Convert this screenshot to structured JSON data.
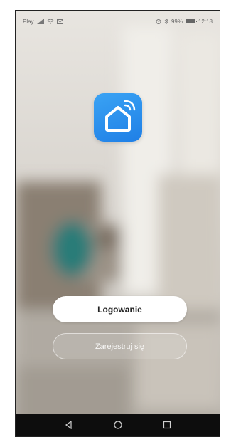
{
  "status_bar": {
    "carrier": "Play",
    "battery_percent": "99%",
    "time": "12:18"
  },
  "icons": {
    "signal": "signal-icon",
    "wifi": "wifi-icon",
    "message": "message-icon",
    "alarm": "alarm-icon",
    "bluetooth": "bluetooth-icon",
    "battery": "battery-icon",
    "app_logo": "smart-home-logo-icon",
    "back": "back-icon",
    "home": "home-icon",
    "recents": "recents-icon"
  },
  "auth": {
    "login_label": "Logowanie",
    "register_label": "Zarejestruj się"
  },
  "colors": {
    "logo_blue": "#2b8ff0",
    "login_bg": "#ffffff",
    "nav_bg": "#0d0d0d"
  }
}
